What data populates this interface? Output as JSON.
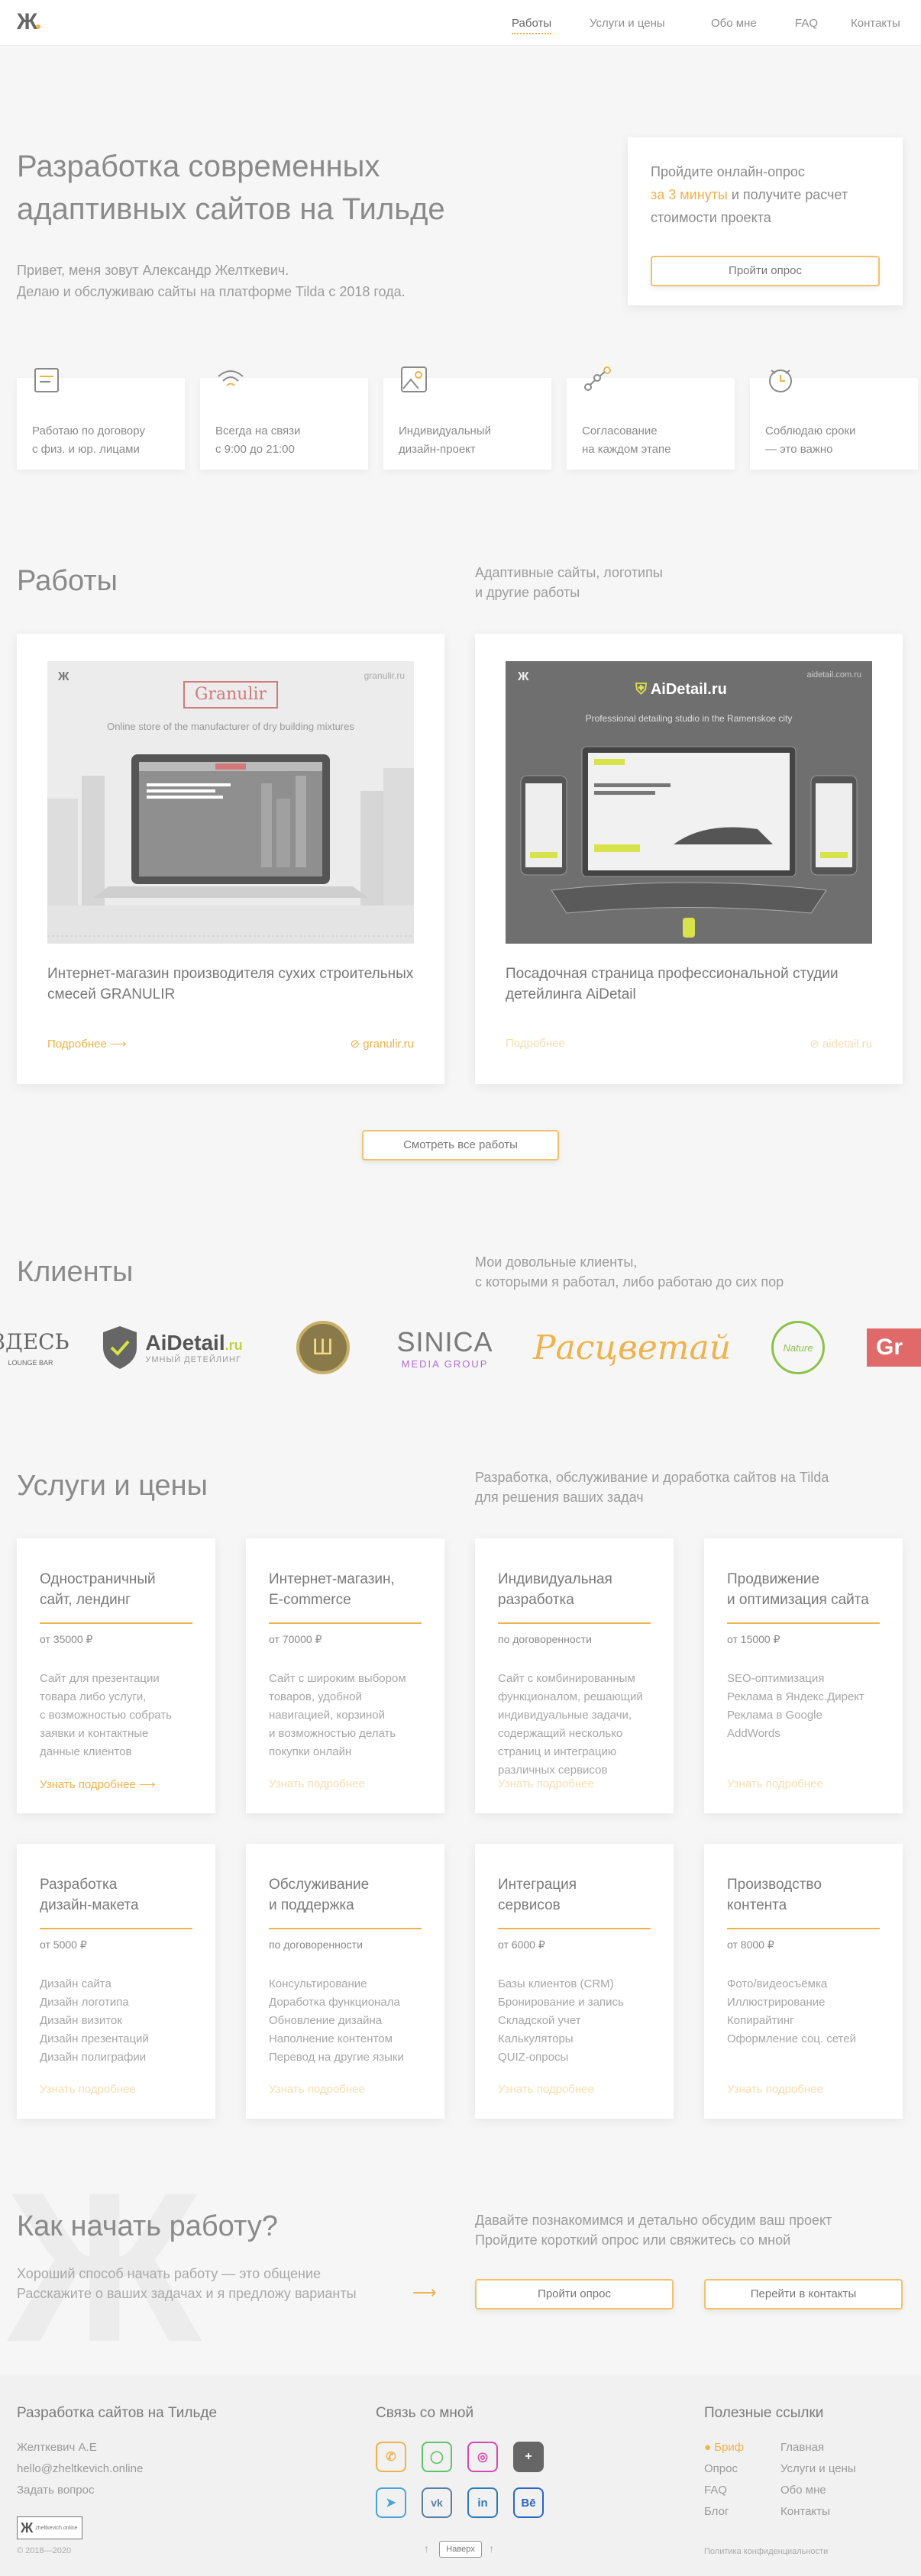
{
  "header": {
    "logo": "Ж",
    "nav": [
      "Работы",
      "Услуги и цены",
      "Обо мне",
      "FAQ",
      "Контакты"
    ]
  },
  "hero": {
    "title": "Разработка современных адаптивных сайтов на Тильде",
    "lead_line1": "Привет, меня зовут Александр Желткевич.",
    "lead_line2": "Делаю и обслуживаю сайты на платформе Tilda с 2018 года.",
    "quiz_text1": "Пройдите онлайн-опрос",
    "quiz_accent": "за 3 минуты",
    "quiz_text2": " и получите расчет стоимости проекта",
    "quiz_button": "Пройти опрос"
  },
  "features": [
    {
      "l1": "Работаю по договору",
      "l2": "с физ. и юр. лицами"
    },
    {
      "l1": "Всегда на связи",
      "l2": "с 9:00 до 21:00"
    },
    {
      "l1": "Индивидуальный",
      "l2": "дизайн-проект"
    },
    {
      "l1": "Согласование",
      "l2": "на каждом этапе"
    },
    {
      "l1": "Соблюдаю сроки",
      "l2": "— это важно"
    }
  ],
  "works": {
    "title": "Работы",
    "subtitle_l1": "Адаптивные сайты, логотипы",
    "subtitle_l2": "и другие работы",
    "items": [
      {
        "title": "Интернет-магазин производителя сухих строительных смесей GRANULIR",
        "more": "Подробнее",
        "site": "granulir.ru",
        "img_brand": "Granulir",
        "img_sub": "Online store of the manufacturer of dry building mixtures",
        "img_url": "granulir.ru",
        "img_screen_text": "Производство и поставка инновационных строительных смесей по всей России"
      },
      {
        "title": "Посадочная страница профессиональной студии детейлинга AiDetail",
        "more": "Подробнее",
        "site": "aidetail.ru",
        "img_brand": "AiDetail.ru",
        "img_sub": "Professional detailing studio in the Ramenskoe city",
        "img_url": "aidetail.com.ru"
      }
    ],
    "all_button": "Смотреть все работы"
  },
  "clients": {
    "title": "Клиенты",
    "subtitle_l1": "Мои довольные клиенты,",
    "subtitle_l2": "с которыми я работал, либо работаю до сих пор",
    "logos": [
      {
        "name": "ЗДЕСЬ",
        "sub": "LOUNGE BAR"
      },
      {
        "name": "AiDetail",
        "suffix": ".ru",
        "sub": "УМНЫЙ ДЕТЕЙЛИНГ"
      },
      {
        "name": "Ш"
      },
      {
        "name": "SINICA",
        "sub": "MEDIA GROUP"
      },
      {
        "name": "Расцветай"
      },
      {
        "name": "Nature"
      },
      {
        "name": "Gr"
      }
    ]
  },
  "services": {
    "title": "Услуги и цены",
    "subtitle_l1": "Разработка, обслуживание и доработка сайтов на Tilda",
    "subtitle_l2": "для решения ваших задач",
    "more_label": "Узнать подробнее",
    "items": [
      {
        "n1": "Одностраничный",
        "n2": "сайт, лендинг",
        "price": "от 35000 ₽",
        "desc": [
          "Сайт для презентации",
          "товара либо услуги,",
          "с возможностью собрать",
          "заявки и контактные",
          "данные клиентов"
        ]
      },
      {
        "n1": "Интернет-магазин,",
        "n2": "E-commerce",
        "price": "от 70000 ₽",
        "desc": [
          "Сайт с широким выбором",
          "товаров, удобной",
          "навигацией, корзиной",
          "и возможностью делать",
          "покупки онлайн"
        ]
      },
      {
        "n1": "Индивидуальная",
        "n2": "разработка",
        "price": "по договоренности",
        "desc": [
          "Сайт с комбинированным",
          "функционалом, решающий",
          "индивидуальные задачи,",
          "содержащий несколько",
          "страниц и интеграцию",
          "различных сервисов"
        ]
      },
      {
        "n1": "Продвижение",
        "n2": "и оптимизация сайта",
        "price": "от 15000 ₽",
        "desc": [
          "SEO-оптимизация",
          "Реклама в Яндекс.Директ",
          "Реклама в Google",
          "AddWords"
        ]
      },
      {
        "n1": "Разработка",
        "n2": "дизайн-макета",
        "price": "от 5000 ₽",
        "desc": [
          "Дизайн сайта",
          "Дизайн логотипа",
          "Дизайн визиток",
          "Дизайн презентаций",
          "Дизайн полиграфии"
        ]
      },
      {
        "n1": "Обслуживание",
        "n2": "и поддержка",
        "price": "по договоренности",
        "desc": [
          "Консультирование",
          "Доработка функционала",
          "Обновление дизайна",
          "Наполнение контентом",
          "Перевод на другие языки"
        ]
      },
      {
        "n1": "Интеграция",
        "n2": "сервисов",
        "price": "от 6000 ₽",
        "desc": [
          "Базы клиентов (CRM)",
          "Бронирование и запись",
          "Складской учет",
          "Калькуляторы",
          "QUIZ-опросы"
        ]
      },
      {
        "n1": "Производство",
        "n2": "контента",
        "price": "от 8000 ₽",
        "desc": [
          "Фото/видеосъёмка",
          "Иллюстрирование",
          "Копирайтинг",
          "Оформление соц. сетей"
        ]
      }
    ]
  },
  "start": {
    "title": "Как начать работу?",
    "text_l1": "Хороший способ начать работу — это общение",
    "text_l2": "Расскажите о ваших задачах и я предложу варианты",
    "sub_l1": "Давайте познакомимся и детально обсудим ваш проект",
    "sub_l2": "Пройдите короткий опрос или свяжитесь со мной",
    "btn_quiz": "Пройти опрос",
    "btn_contacts": "Перейти в контакты"
  },
  "footer": {
    "col1_title": "Разработка сайтов на Тильде",
    "name": "Желткевич А.Е",
    "email": "hello@zheltkevich.online",
    "ask": "Задать вопрос",
    "badge": "zheltkevich.online",
    "copyright": "© 2018—2020",
    "col2_title": "Связь со мной",
    "col3_title": "Полезные ссылки",
    "links_left": [
      "Бриф",
      "Опрос",
      "FAQ",
      "Блог"
    ],
    "links_right": [
      "Главная",
      "Услуги и цены",
      "Обо мне",
      "Контакты"
    ],
    "policy": "Политика конфиденциальности",
    "up_label": "Наверх"
  },
  "colors": {
    "accent": "#f0b24c",
    "text": "#8a8a8a"
  }
}
